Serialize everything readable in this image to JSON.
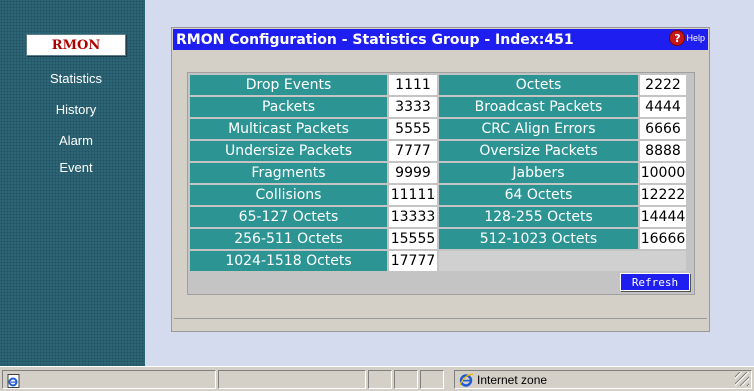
{
  "sidebar": {
    "active_button": "RMON",
    "items": [
      {
        "label": "Statistics"
      },
      {
        "label": "History"
      },
      {
        "label": "Alarm"
      },
      {
        "label": "Event"
      }
    ]
  },
  "panel": {
    "title": "RMON Configuration - Statistics Group - Index:451",
    "help_label": "Help",
    "help_icon": "question-mark-icon",
    "refresh_label": "Refresh"
  },
  "stats": {
    "rows": [
      [
        {
          "label": "Drop Events",
          "value": "1111"
        },
        {
          "label": "Octets",
          "value": "2222"
        }
      ],
      [
        {
          "label": "Packets",
          "value": "3333"
        },
        {
          "label": "Broadcast Packets",
          "value": "4444"
        }
      ],
      [
        {
          "label": "Multicast Packets",
          "value": "5555"
        },
        {
          "label": "CRC Align Errors",
          "value": "6666"
        }
      ],
      [
        {
          "label": "Undersize Packets",
          "value": "7777"
        },
        {
          "label": "Oversize Packets",
          "value": "8888"
        }
      ],
      [
        {
          "label": "Fragments",
          "value": "9999"
        },
        {
          "label": "Jabbers",
          "value": "10000"
        }
      ],
      [
        {
          "label": "Collisions",
          "value": "11111"
        },
        {
          "label": "64 Octets",
          "value": "12222"
        }
      ],
      [
        {
          "label": "65-127 Octets",
          "value": "13333"
        },
        {
          "label": "128-255 Octets",
          "value": "14444"
        }
      ],
      [
        {
          "label": "256-511 Octets",
          "value": "15555"
        },
        {
          "label": "512-1023 Octets",
          "value": "16666"
        }
      ],
      [
        {
          "label": "1024-1518 Octets",
          "value": "17777"
        }
      ]
    ]
  },
  "statusbar": {
    "zone": "Internet zone",
    "page_icon": "ie-page-icon",
    "zone_icon": "ie-globe-icon"
  },
  "colors": {
    "sidebar_bg": "#2c6576",
    "title_bar": "#1e1ef0",
    "stat_label_bg": "#2d9494",
    "rmon_text": "#b00000"
  }
}
